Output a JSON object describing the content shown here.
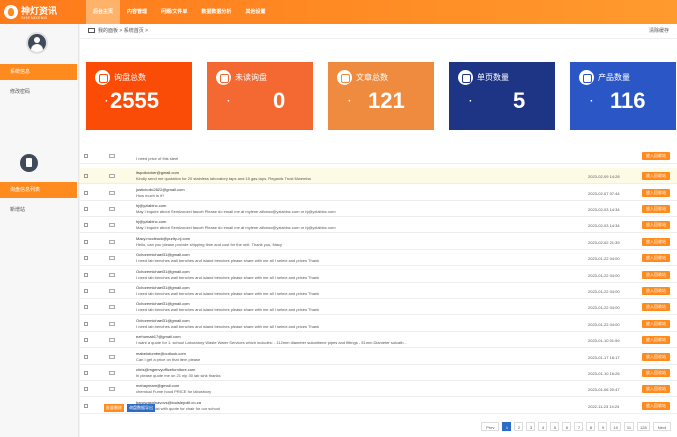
{
  "app": {
    "name": "神灯资讯",
    "sub": "SHENDENG"
  },
  "nav": [
    "后台主页",
    "内容管理",
    "问题/文件单",
    "数据数据分析",
    "其他设置"
  ],
  "sidebar": {
    "top_items": [
      "系统信息",
      "修改密码"
    ],
    "bottom_items": [
      "询盘信息列表",
      "新增站"
    ]
  },
  "header": {
    "breadcrumb": "我的面板 > 系统首页 >",
    "clear": "清除缓存"
  },
  "cards": [
    {
      "label": "询盘总数",
      "value": "2555",
      "color": "#fb4c07"
    },
    {
      "label": "未读询盘",
      "value": "0",
      "color": "#f46932"
    },
    {
      "label": "文章总数",
      "value": "121",
      "color": "#ef8b3f"
    },
    {
      "label": "单页数量",
      "value": "5",
      "color": "#1e3484"
    },
    {
      "label": "产品数量",
      "value": "116",
      "color": "#2a56c6"
    }
  ],
  "table": {
    "action_label": "放入回收站",
    "rows": [
      {
        "from": "",
        "message": "I need price of this steel",
        "date": ""
      },
      {
        "from": "itspolicicker@gmail.com",
        "message": "Kindly send me quotation for 20 stainless laboratory taps and 15 gas taps. Regards Trust Mwemba",
        "date": "2023-02-09 14:28"
      },
      {
        "from": "justicholic2822@gmail.com",
        "message": "How much is it?",
        "date": "2023-02-07 07:44"
      },
      {
        "from": "hj@yzlabinc.com",
        "message": "May i inquire about Semizonzel faucet Please do email me at mylene alfonso@yzlabinc.com or hj@yzlabinc.com",
        "date": "2023-02-03 14:34"
      },
      {
        "from": "hj@yzlabinc.com",
        "message": "May i inquire about Semizonzel faucet Please do email me at mylene alfonso@yzlabinc.com or hj@yzlabinc.com",
        "date": "2023-02-03 14:34"
      },
      {
        "from": "Macy.mccleuck@purity-nj.com",
        "message": "Hello, can you please provide shipping time and cost for the unit. Thank you, Macy",
        "date": "2023-02-02 21:39"
      },
      {
        "from": "Ochoremichael31@gmail.com",
        "message": "I need lab benches wall benches and island benches please share with me all I select and prices Thank",
        "date": "2023-01-22 04:00"
      },
      {
        "from": "Ochoremichael31@gmail.com",
        "message": "I need lab benches wall benches and island benches please share with me all I select and prices Thank",
        "date": "2023-01-22 04:00"
      },
      {
        "from": "Ochoremichael31@gmail.com",
        "message": "I need lab benches wall benches and island benches please share with me all I select and prices Thank",
        "date": "2023-01-22 04:00"
      },
      {
        "from": "Ochoremichael31@gmail.com",
        "message": "I need lab benches wall benches and island benches please share with me all I select and prices Thank",
        "date": "2023-01-22 04:00"
      },
      {
        "from": "Ochoremichael31@gmail.com",
        "message": "I need lab benches wall benches and island benches please share with me all I select and prices Thank",
        "date": "2023-01-22 04:00"
      },
      {
        "from": "ezrhumab17@gmail.com",
        "message": "I want a quote for 1. school Laboratory Waste Water Services which includes: - 112mm diameter sulcathene pipes and fittings - 51mm Diameter sulcath...",
        "date": "2023-01-10 01:59"
      },
      {
        "from": "mabelotumbe@outlook.com",
        "message": "Can I get a price on that item please",
        "date": "2023-01-17 16:17"
      },
      {
        "from": "chris@mgenvyofficefurniture.com",
        "message": "hi please quote me on 21 nip 30 lab sink thanks",
        "date": "2023-01-10 16:26"
      },
      {
        "from": "mehaymam@gmail.com",
        "message": "chemical Fume hood PRICE for laboratory",
        "date": "2023-01-06 20:47"
      },
      {
        "from": "bancwasnlnavovs@louislepolit.co.za",
        "message": "Please assist with quote for chair for our school",
        "date": "2022-11-23 14:24"
      }
    ],
    "bottom_buttons": [
      "批量删除",
      "询盘数据导出"
    ]
  },
  "pagination": [
    "Prev",
    "1",
    "2",
    "3",
    "4",
    "5",
    "6",
    "7",
    "8",
    "9",
    "10",
    "11",
    "128",
    "Next"
  ],
  "pagination_current": "1"
}
